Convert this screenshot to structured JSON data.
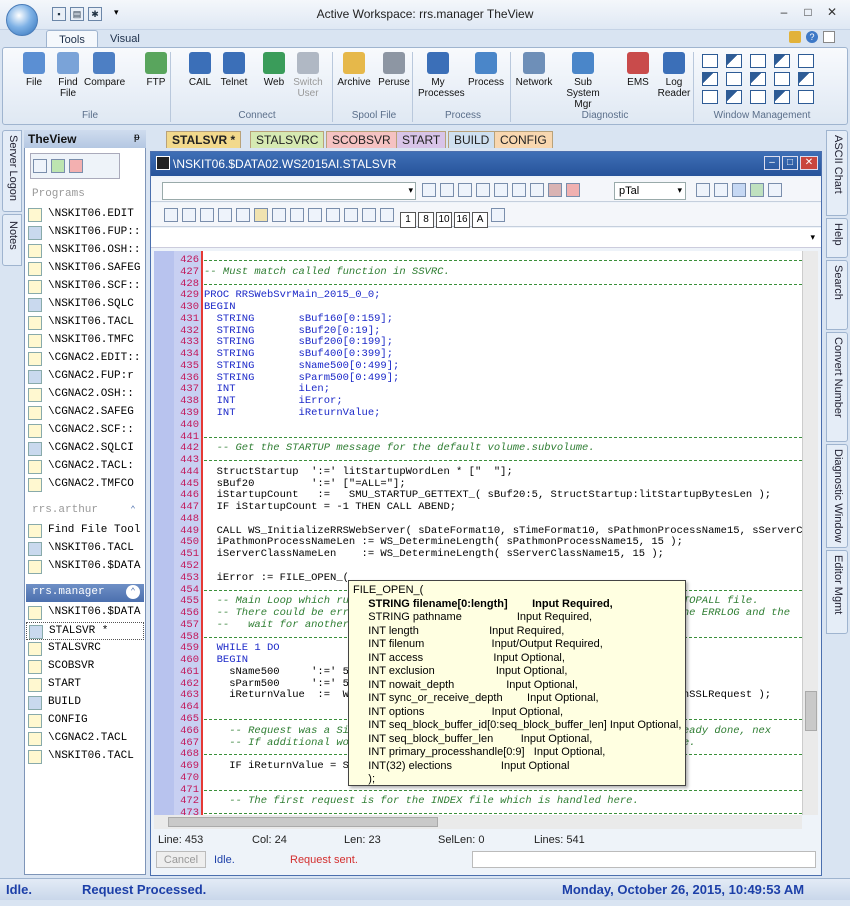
{
  "window": {
    "title": "Active Workspace: rrs.manager  TheView",
    "minimize": "–",
    "restore": "□",
    "close": "✕",
    "qa_items": [
      "save",
      "print",
      "settings",
      "dropdown"
    ]
  },
  "ribbon": {
    "tabs": [
      "Tools",
      "Visual"
    ],
    "active_tab": "Tools",
    "groups": [
      {
        "label": "File",
        "buttons": [
          [
            "File"
          ],
          [
            "Find",
            "File"
          ],
          [
            "Compare"
          ],
          [
            "FTP"
          ]
        ]
      },
      {
        "label": "Connect",
        "buttons": [
          [
            "CAIL"
          ],
          [
            "Telnet"
          ],
          [
            "Web"
          ],
          [
            "Switch",
            "User"
          ]
        ]
      },
      {
        "label": "Spool File",
        "buttons": [
          [
            "Archive"
          ],
          [
            "Peruse"
          ]
        ]
      },
      {
        "label": "Process",
        "buttons": [
          [
            "My",
            "Processes"
          ],
          [
            "Process"
          ]
        ]
      },
      {
        "label": "Diagnostic",
        "buttons": [
          [
            "Network"
          ],
          [
            "Sub System",
            "Mgr"
          ],
          [
            "EMS"
          ],
          [
            "Log",
            "Reader"
          ]
        ]
      },
      {
        "label": "Window Management",
        "buttons": []
      }
    ],
    "help_icons": [
      "lock-icon",
      "help-icon",
      "close-ribbon-icon"
    ]
  },
  "left_tabs": [
    "Server Logon",
    "Notes"
  ],
  "right_tabs": [
    "ASCII Chart",
    "Help",
    "Search",
    "Convert Number",
    "Diagnostic Window",
    "Editor Mgmt"
  ],
  "theview": {
    "title": "TheView",
    "pin": "ᵽ",
    "sections": [
      {
        "title": "Programs",
        "items": [
          "\\NSKIT06.EDIT",
          "\\NSKIT06.FUP::",
          "\\NSKIT06.OSH::",
          "\\NSKIT06.SAFEG",
          "\\NSKIT06.SCF::",
          "\\NSKIT06.SQLC",
          "\\NSKIT06.TACL",
          "\\NSKIT06.TMFC",
          "\\CGNAC2.EDIT::",
          "\\CGNAC2.FUP:r",
          "\\CGNAC2.OSH::",
          "\\CGNAC2.SAFEG",
          "\\CGNAC2.SCF::",
          "\\CGNAC2.SQLCI",
          "\\CGNAC2.TACL:",
          "\\CGNAC2.TMFCO"
        ]
      },
      {
        "title": "rrs.arthur",
        "items": [
          "Find File Tool",
          "\\NSKIT06.TACL",
          "\\NSKIT06.$DATA"
        ]
      },
      {
        "title": "rrs.manager",
        "items": [
          "\\NSKIT06.$DATA",
          "STALSVR *",
          "STALSVRC",
          "SCOBSVR",
          "START",
          "BUILD",
          "CONFIG",
          "\\CGNAC2.TACL",
          "\\NSKIT06.TACL"
        ]
      }
    ]
  },
  "doc_tabs": [
    {
      "label": "STALSVR *",
      "color": "#f2d98c"
    },
    {
      "label": "STALSVRC",
      "color": "#d6e9b2"
    },
    {
      "label": "SCOBSVR",
      "color": "#f5c2c2"
    },
    {
      "label": "START",
      "color": "#d8c4e8"
    },
    {
      "label": "BUILD",
      "color": "#cfe0f0"
    },
    {
      "label": "CONFIG",
      "color": "#f8d7b0"
    }
  ],
  "editor": {
    "title": "\\NSKIT06.$DATA02.WS2015AI.STALSVR",
    "language": "pTal",
    "numbers": [
      "1",
      "8",
      "10",
      "16",
      "A"
    ],
    "status": {
      "line": "Line: 453",
      "col": "Col: 24",
      "len": "Len: 23",
      "sellen": "SelLen: 0",
      "lines": "Lines: 541"
    },
    "cancel": "Cancel",
    "idle": "Idle.",
    "request": "Request sent."
  },
  "code": [
    {
      "n": "426",
      "d": true
    },
    {
      "n": "427",
      "t": "-- Must match called function in SSVRC.",
      "c": "cm"
    },
    {
      "n": "428",
      "d": true
    },
    {
      "n": "429",
      "t": "PROC RRSWebSvrMain_2015_0_0;",
      "c": "kw"
    },
    {
      "n": "430",
      "t": "BEGIN",
      "c": "kw"
    },
    {
      "n": "431",
      "t": "  STRING       sBuf160[0:159];",
      "c": "kw"
    },
    {
      "n": "432",
      "t": "  STRING       sBuf20[0:19];",
      "c": "kw"
    },
    {
      "n": "433",
      "t": "  STRING       sBuf200[0:199];",
      "c": "kw"
    },
    {
      "n": "434",
      "t": "  STRING       sBuf400[0:399];",
      "c": "kw"
    },
    {
      "n": "435",
      "t": "  STRING       sName500[0:499];",
      "c": "kw"
    },
    {
      "n": "436",
      "t": "  STRING       sParm500[0:499];",
      "c": "kw"
    },
    {
      "n": "437",
      "t": "  INT          iLen;",
      "c": "kw"
    },
    {
      "n": "438",
      "t": "  INT          iError;",
      "c": "kw"
    },
    {
      "n": "439",
      "t": "  INT          iReturnValue;",
      "c": "kw"
    },
    {
      "n": "440",
      "t": ""
    },
    {
      "n": "441",
      "d": true
    },
    {
      "n": "442",
      "t": "  -- Get the STARTUP message for the default volume.subvolume.",
      "c": "cm"
    },
    {
      "n": "443",
      "d": true
    },
    {
      "n": "444",
      "t": "  StructStartup  ':=' litStartupWordLen * [\"  \"];"
    },
    {
      "n": "445",
      "t": "  sBuf20         ':=' [\"=ALL=\"];"
    },
    {
      "n": "446",
      "t": "  iStartupCount   :=   SMU_STARTUP_GETTEXT_( sBuf20:5, StructStartup:litStartupBytesLen );"
    },
    {
      "n": "447",
      "t": "  IF iStartupCount = -1 THEN CALL ABEND;"
    },
    {
      "n": "448",
      "t": ""
    },
    {
      "n": "449",
      "t": "  CALL WS_InitializeRRSWebServer( sDateFormat10, sTimeFormat10, sPathmonProcessName15, sServerC"
    },
    {
      "n": "450",
      "t": "  iPathmonProcessNameLen := WS_DetermineLength( sPathmonProcessName15, 15 );"
    },
    {
      "n": "451",
      "t": "  iServerClassNameLen    := WS_DetermineLength( sServerClassName15, 15 );"
    },
    {
      "n": "452",
      "t": ""
    },
    {
      "n": "453",
      "t": "  iError := FILE_OPEN_("
    },
    {
      "n": "454",
      "d": true
    },
    {
      "n": "455",
      "t": "  -- Main Loop which ru                                                    STOPALL file.",
      "c": "cm"
    },
    {
      "n": "456",
      "t": "  -- There could be err                                                    the ERRLOG and the",
      "c": "cm"
    },
    {
      "n": "457",
      "t": "  --   wait for another",
      "c": "cm"
    },
    {
      "n": "458",
      "d": true
    },
    {
      "n": "459",
      "t": "  WHILE 1 DO",
      "c": "kw"
    },
    {
      "n": "460",
      "t": "  BEGIN",
      "c": "kw"
    },
    {
      "n": "461",
      "t": "    sName500     ':=' 50"
    },
    {
      "n": "462",
      "t": "    sParm500     ':=' 50"
    },
    {
      "n": "463",
      "t": "    iReturnValue  :=  WS                                                  NonSSLRequest );"
    },
    {
      "n": "464",
      "t": ""
    },
    {
      "n": "465",
      "d": true
    },
    {
      "n": "466",
      "t": "    -- Request was a Si                                                  already done, nex",
      "c": "cm"
    },
    {
      "n": "467",
      "t": "    -- If additional wo                                                  here.",
      "c": "cm"
    },
    {
      "n": "468",
      "d": true
    },
    {
      "n": "469",
      "t": "    IF iReturnValue = S"
    },
    {
      "n": "470",
      "t": ""
    },
    {
      "n": "471",
      "d": true
    },
    {
      "n": "472",
      "t": "    -- The first request is for the INDEX file which is handled here.",
      "c": "cm"
    },
    {
      "n": "473",
      "d": true
    }
  ],
  "tooltip": [
    "FILE_OPEN_(",
    "     STRING filename[0:length]        Input Required,",
    "     STRING pathname                  Input Required,",
    "     INT length                       Input Required,",
    "     INT filenum                      Input/Output Required,",
    "     INT access                       Input Optional,",
    "     INT exclusion                    Input Optional,",
    "     INT nowait_depth                 Input Optional,",
    "     INT sync_or_receive_depth        Input Optional,",
    "     INT options                      Input Optional,",
    "     INT seq_block_buffer_id[0:seq_block_buffer_len] Input Optional,",
    "     INT seq_block_buffer_len         Input Optional,",
    "     INT primary_processhandle[0:9]   Input Optional,",
    "     INT(32) elections                Input Optional",
    "     );"
  ],
  "statusbar": {
    "state": "Idle.",
    "message": "Request Processed.",
    "datetime": "Monday, October 26, 2015,  10:49:53 AM"
  }
}
